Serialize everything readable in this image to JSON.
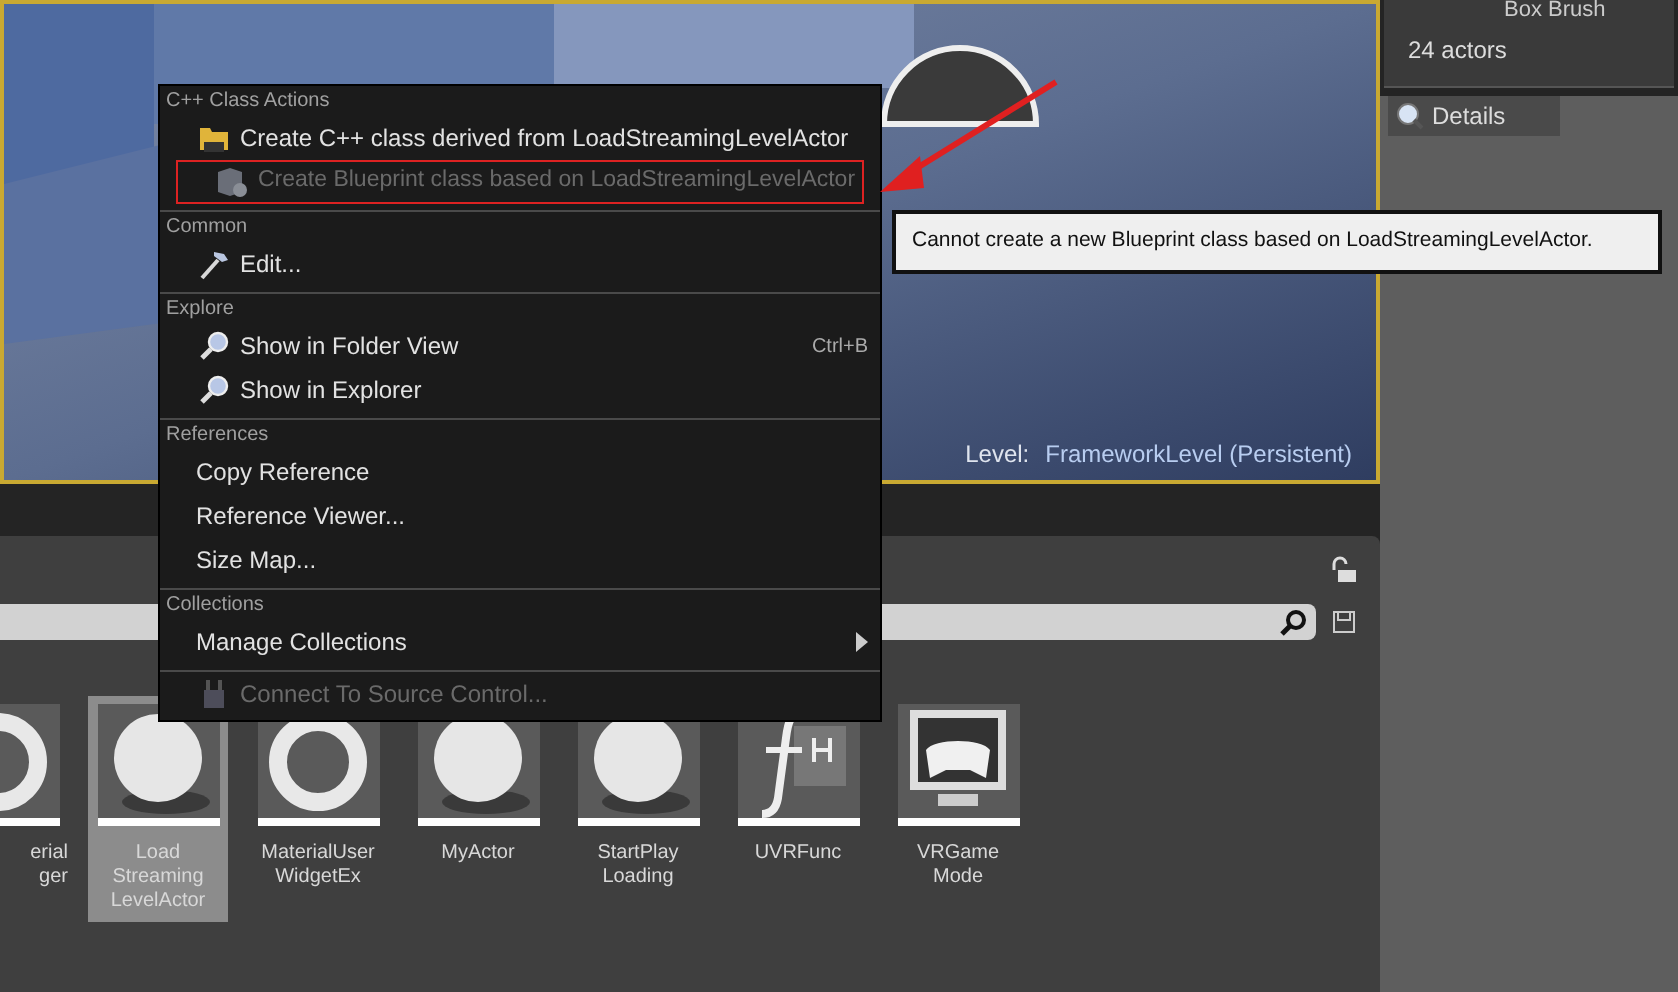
{
  "outliner": {
    "cut_row": "Box Brush",
    "count": "24 actors"
  },
  "details_tab": {
    "label": "Details"
  },
  "viewport": {
    "level_label": "Level:",
    "level_name": "FrameworkLevel (Persistent)"
  },
  "content_browser": {
    "assets": [
      {
        "lines": [
          "erial",
          "ger"
        ],
        "kind": "ring",
        "selected": false,
        "cut": true
      },
      {
        "lines": [
          "Load",
          "Streaming",
          "LevelActor"
        ],
        "kind": "sphere",
        "selected": true,
        "cut": false
      },
      {
        "lines": [
          "MaterialUser",
          "WidgetEx"
        ],
        "kind": "ring",
        "selected": false,
        "cut": false
      },
      {
        "lines": [
          "MyActor"
        ],
        "kind": "sphere",
        "selected": false,
        "cut": false
      },
      {
        "lines": [
          "StartPlay",
          "Loading"
        ],
        "kind": "sphere",
        "selected": false,
        "cut": false
      },
      {
        "lines": [
          "UVRFunc"
        ],
        "kind": "function",
        "selected": false,
        "cut": false
      },
      {
        "lines": [
          "VRGame",
          "Mode"
        ],
        "kind": "gamepad",
        "selected": false,
        "cut": false
      }
    ]
  },
  "context_menu": {
    "sections": [
      {
        "heading": "C++ Class Actions",
        "items": [
          {
            "label": "Create C++ class derived from LoadStreamingLevelActor",
            "kind": "cpp",
            "disabled": false,
            "highlighted": false
          },
          {
            "label": "Create Blueprint class based on LoadStreamingLevelActor",
            "kind": "blueprint",
            "disabled": true,
            "highlighted": true
          }
        ]
      },
      {
        "heading": "Common",
        "items": [
          {
            "label": "Edit...",
            "kind": "hammer",
            "disabled": false,
            "highlighted": false
          }
        ]
      },
      {
        "heading": "Explore",
        "items": [
          {
            "label": "Show in Folder View",
            "kind": "magnifier",
            "disabled": false,
            "highlighted": false,
            "shortcut": "Ctrl+B"
          },
          {
            "label": "Show in Explorer",
            "kind": "magnifier",
            "disabled": false,
            "highlighted": false
          }
        ]
      },
      {
        "heading": "References",
        "items": [
          {
            "label": "Copy Reference",
            "kind": "plain",
            "disabled": false,
            "highlighted": false
          },
          {
            "label": "Reference Viewer...",
            "kind": "plain",
            "disabled": false,
            "highlighted": false
          },
          {
            "label": "Size Map...",
            "kind": "plain",
            "disabled": false,
            "highlighted": false
          }
        ]
      },
      {
        "heading": "Collections",
        "items": [
          {
            "label": "Manage Collections",
            "kind": "plain",
            "disabled": false,
            "highlighted": false,
            "submenu": true
          }
        ]
      },
      {
        "items": [
          {
            "label": "Connect To Source Control...",
            "kind": "plug",
            "disabled": true,
            "highlighted": false
          }
        ]
      }
    ]
  },
  "tooltip": {
    "text": "Cannot create a new Blueprint class based on LoadStreamingLevelActor."
  }
}
